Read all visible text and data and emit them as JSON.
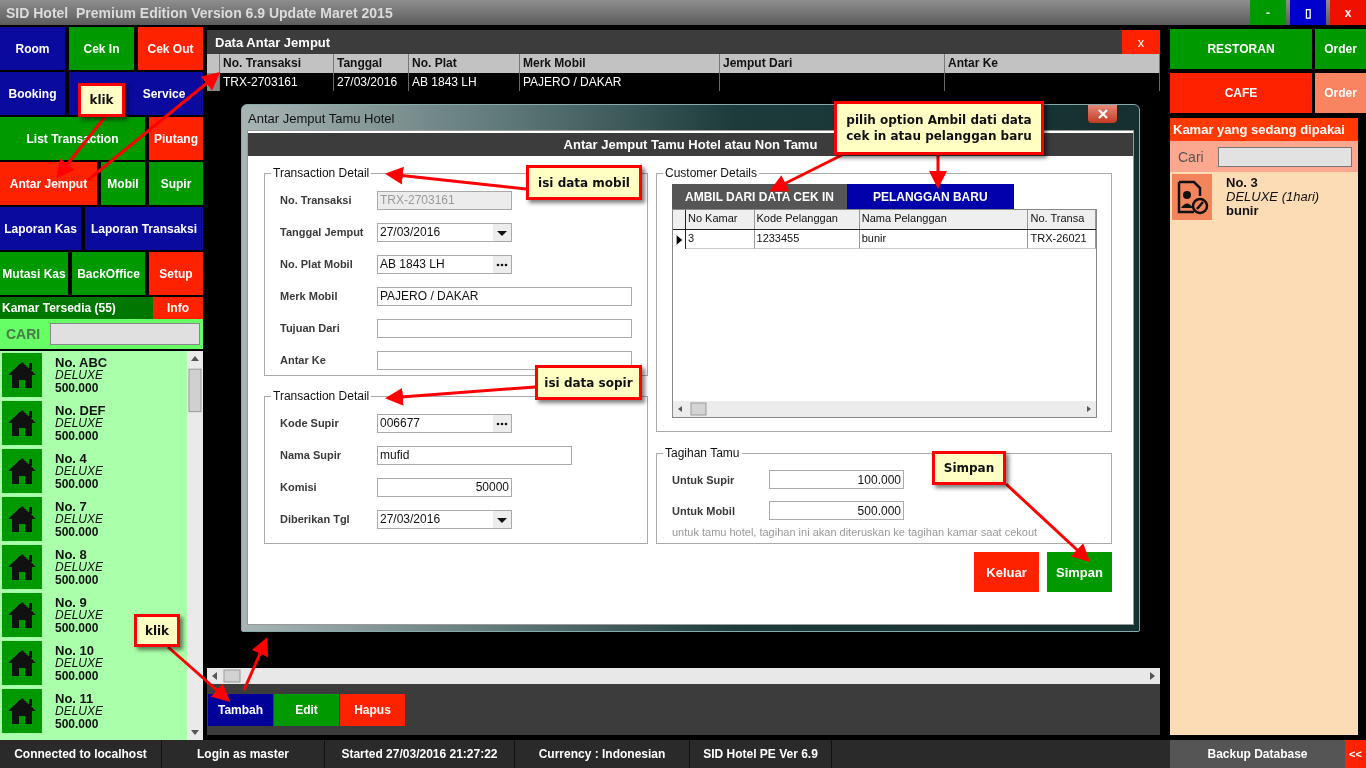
{
  "window": {
    "title": "SID Hotel  Premium Edition Version 6.9 Update Maret 2015",
    "controls": [
      {
        "label": "-",
        "color": "#009900"
      },
      {
        "label": "▯",
        "color": "#0000cc"
      },
      {
        "label": "x",
        "color": "#ee1100"
      }
    ]
  },
  "menu_rows": [
    [
      {
        "label": "Room",
        "color": "#0a0a9e"
      },
      {
        "label": "Cek In",
        "color": "#009900"
      },
      {
        "label": "Cek Out",
        "color": "#ff2200"
      }
    ],
    [
      {
        "label": "Booking",
        "color": "#0a0a9e"
      },
      {
        "label": "Service",
        "color": "#0a0a9e"
      }
    ],
    [
      {
        "label": "List Transaction",
        "color": "#009900"
      },
      {
        "label": "Piutang",
        "color": "#ff2200"
      }
    ],
    [
      {
        "label": "Antar Jemput",
        "color": "#ff2200"
      },
      {
        "label": "Mobil",
        "color": "#009900"
      },
      {
        "label": "Supir",
        "color": "#009900"
      }
    ],
    [
      {
        "label": "Laporan Kas",
        "color": "#0a0a9e"
      },
      {
        "label": "Laporan Transaksi",
        "color": "#0a0a9e"
      }
    ],
    [
      {
        "label": "Mutasi Kas",
        "color": "#009900"
      },
      {
        "label": "BackOffice",
        "color": "#009900"
      },
      {
        "label": "Setup",
        "color": "#ff2200"
      }
    ]
  ],
  "available_rooms": {
    "title": "Kamar Tersedia (55)",
    "info": "Info",
    "search_label": "CARI",
    "rooms": [
      {
        "name": "No. ABC",
        "type": "DELUXE",
        "price": "500.000"
      },
      {
        "name": "No. DEF",
        "type": "DELUXE",
        "price": "500.000"
      },
      {
        "name": "No. 4",
        "type": "DELUXE",
        "price": "500.000"
      },
      {
        "name": "No. 7",
        "type": "DELUXE",
        "price": "500.000"
      },
      {
        "name": "No. 8",
        "type": "DELUXE",
        "price": "500.000"
      },
      {
        "name": "No. 9",
        "type": "DELUXE",
        "price": "500.000"
      },
      {
        "name": "No. 10",
        "type": "DELUXE",
        "price": "500.000"
      },
      {
        "name": "No. 11",
        "type": "DELUXE",
        "price": "500.000"
      }
    ]
  },
  "data_panel": {
    "title": "Data Antar Jemput",
    "close": "x",
    "columns": [
      "No. Transaksi",
      "Tanggal",
      "No. Plat",
      "Merk Mobil",
      "Jemput Dari",
      "Antar Ke"
    ],
    "rows": [
      [
        "TRX-2703161",
        "27/03/2016",
        "AB 1843 LH",
        "PAJERO / DAKAR"
      ]
    ],
    "buttons": [
      {
        "label": "Tambah",
        "color": "#000099"
      },
      {
        "label": "Edit",
        "color": "#009900"
      },
      {
        "label": "Hapus",
        "color": "#ff2200"
      }
    ]
  },
  "dialog": {
    "title": "Antar Jemput Tamu Hotel",
    "header": "Antar Jemput Tamu Hotel atau Non Tamu",
    "car_group": {
      "title": "Transaction Detail",
      "fields": [
        {
          "label": "No. Transaksi",
          "value": "TRX-2703161",
          "kind": "readonly"
        },
        {
          "label": "Tanggal Jemput",
          "value": "27/03/2016",
          "kind": "date"
        },
        {
          "label": "No. Plat Mobil",
          "value": "AB 1843 LH",
          "kind": "lookup"
        },
        {
          "label": "Merk Mobil",
          "value": "PAJERO / DAKAR",
          "kind": "wide"
        },
        {
          "label": "Tujuan Dari",
          "kind": "wide"
        },
        {
          "label": "Antar Ke",
          "kind": "wide"
        }
      ]
    },
    "driver_group": {
      "title": "Transaction Detail",
      "fields": [
        {
          "label": "Kode Supir",
          "value": "006677",
          "kind": "lookup"
        },
        {
          "label": "Nama Supir",
          "value": "mufid",
          "kind": "medium"
        },
        {
          "label": "Komisi",
          "value": "50000",
          "kind": "number"
        },
        {
          "label": "Diberikan Tgl",
          "value": "27/03/2016",
          "kind": "date"
        }
      ]
    },
    "customer": {
      "title": "Customer Details",
      "tabs": [
        {
          "label": "AMBIL DARI DATA CEK IN",
          "selected": false
        },
        {
          "label": "PELANGGAN BARU",
          "selected": true
        }
      ],
      "columns": [
        "No Kamar",
        "Kode Pelanggan",
        "Nama Pelanggan",
        "No. Transa"
      ],
      "rows": [
        {
          "cells": [
            "3",
            "1233455",
            "bunir",
            "TRX-26021"
          ],
          "selected": true
        }
      ]
    },
    "billing": {
      "title": "Tagihan Tamu",
      "fields": [
        {
          "label": "Untuk Supir",
          "value": "100.000"
        },
        {
          "label": "Untuk Mobil",
          "value": "500.000"
        }
      ],
      "note": "untuk tamu hotel, tagihan ini akan diteruskan ke tagihan kamar saat cekout"
    },
    "buttons": [
      {
        "label": "Keluar",
        "color": "#ff2200"
      },
      {
        "label": "Simpan",
        "color": "#009900"
      }
    ]
  },
  "right_panel": {
    "outlets": [
      {
        "label": "RESTORAN",
        "color": "#009900",
        "order": {
          "label": "Order",
          "color": "#009900"
        }
      },
      {
        "label": "CAFE",
        "color": "#ff2200",
        "order": {
          "label": "Order",
          "color": "#f88462"
        }
      }
    ],
    "occupied": {
      "title": "Kamar yang sedang dipakai",
      "search_label": "Cari",
      "rooms": [
        {
          "name": "No. 3",
          "type": "DELUXE (1hari)",
          "guest": "bunir"
        }
      ]
    }
  },
  "status_bar": {
    "items": [
      "Connected to localhost",
      "Login as master",
      "Started 27/03/2016 21:27:22",
      "Currency : Indonesian",
      "SID Hotel PE Ver 6.9"
    ],
    "backup": "Backup Database",
    "toggle": "<<"
  },
  "callouts": [
    "klik",
    "isi data mobil",
    "isi data sopir",
    "pilih option Ambil dati data cek in atau pelanggan baru",
    "Simpan",
    "klik"
  ]
}
